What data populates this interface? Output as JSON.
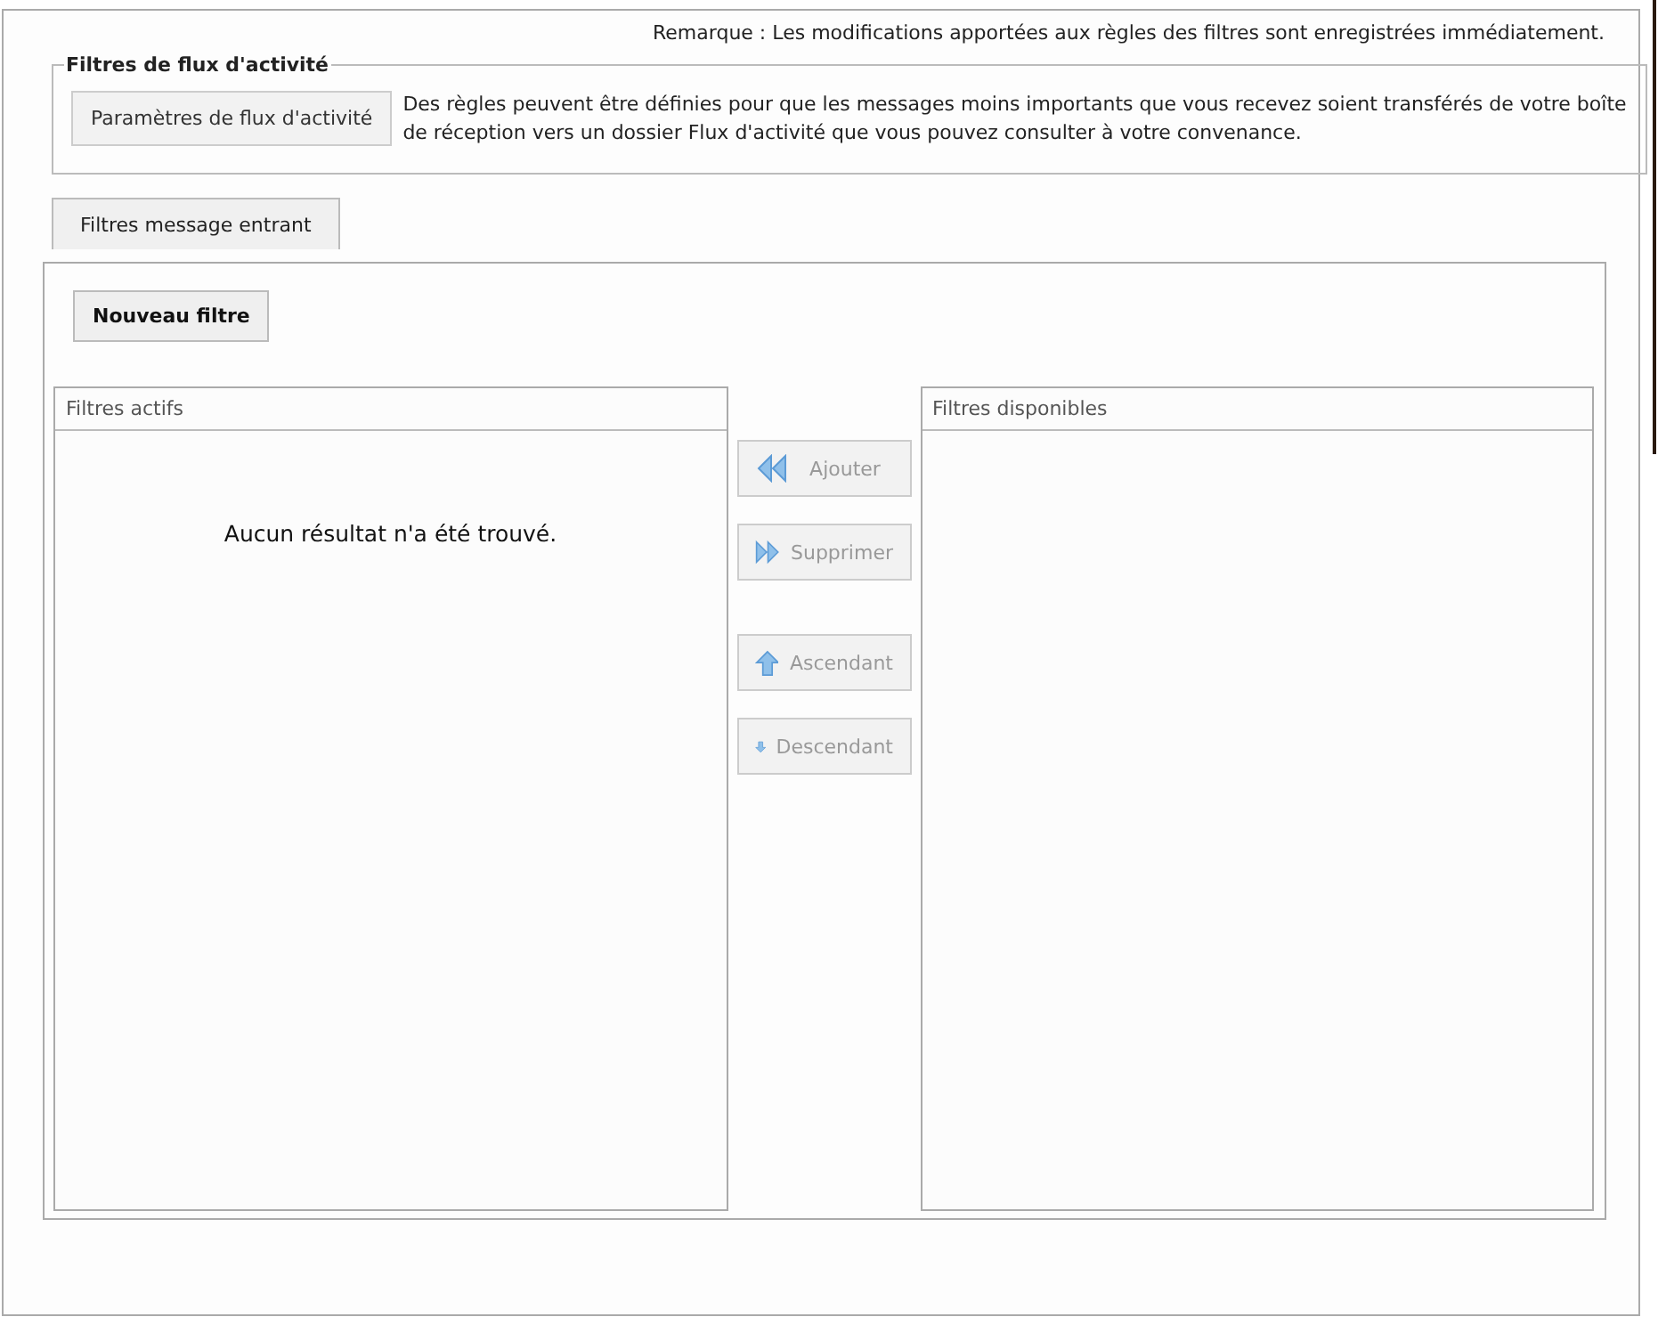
{
  "note": "Remarque : Les modifications apportées aux règles des filtres sont enregistrées immédiatement.",
  "activity_stream": {
    "legend": "Filtres de flux d'activité",
    "button": "Paramètres de flux d'activité",
    "description": "Des règles peuvent être définies pour que les messages moins importants que vous recevez soient transférés de votre boîte de réception vers un dossier Flux d'activité que vous pouvez consulter à votre convenance."
  },
  "tabs": [
    {
      "label": "Filtres message entrant",
      "selected": true
    }
  ],
  "new_filter_button": "Nouveau filtre",
  "active_filters": {
    "title": "Filtres actifs",
    "empty_message": "Aucun résultat n'a été trouvé."
  },
  "actions": [
    {
      "kind": "add",
      "label": "Ajouter",
      "disabled": true
    },
    {
      "kind": "remove",
      "label": "Supprimer",
      "disabled": true
    },
    {
      "kind": "up",
      "label": "Ascendant",
      "disabled": true
    },
    {
      "kind": "down",
      "label": "Descendant",
      "disabled": true
    }
  ],
  "available_filters": {
    "title": "Filtres disponibles"
  }
}
